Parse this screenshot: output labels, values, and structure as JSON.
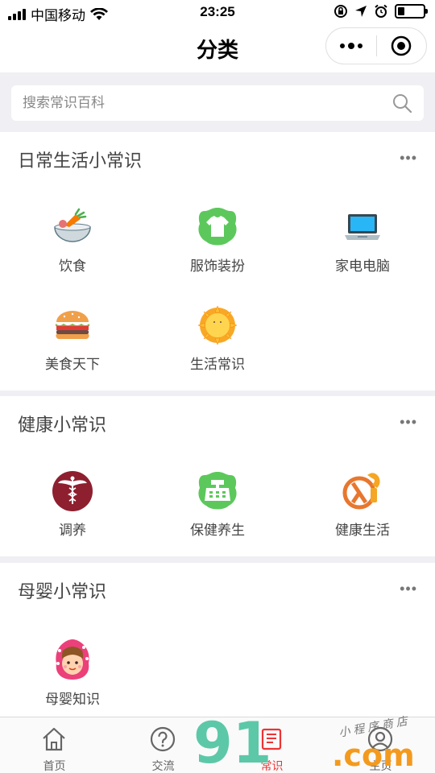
{
  "status_bar": {
    "carrier": "中国移动",
    "time": "23:25"
  },
  "navbar": {
    "title": "分类"
  },
  "search": {
    "placeholder": "搜索常识百科"
  },
  "sections": [
    {
      "title": "日常生活小常识",
      "more": "•••",
      "items": [
        {
          "label": "饮食",
          "icon": "food-bowl-icon"
        },
        {
          "label": "服饰装扮",
          "icon": "tshirt-icon"
        },
        {
          "label": "家电电脑",
          "icon": "laptop-icon"
        },
        {
          "label": "美食天下",
          "icon": "burger-icon"
        },
        {
          "label": "生活常识",
          "icon": "sun-icon"
        }
      ]
    },
    {
      "title": "健康小常识",
      "more": "•••",
      "items": [
        {
          "label": "调养",
          "icon": "caduceus-icon"
        },
        {
          "label": "保健养生",
          "icon": "register-icon"
        },
        {
          "label": "健康生活",
          "icon": "lambda-icon"
        }
      ]
    },
    {
      "title": "母婴小常识",
      "more": "•••",
      "items": [
        {
          "label": "母婴知识",
          "icon": "girl-avatar-icon"
        }
      ]
    }
  ],
  "tabbar": [
    {
      "label": "首页",
      "icon": "home-icon",
      "active": false
    },
    {
      "label": "交流",
      "icon": "question-icon",
      "active": false
    },
    {
      "label": "常识",
      "icon": "book-icon",
      "active": true
    },
    {
      "label": "主页",
      "icon": "user-icon",
      "active": false
    }
  ],
  "watermark": {
    "brand": "91",
    "domain": ".com",
    "caption": "小程序商店"
  },
  "colors": {
    "accent": "#e33333",
    "green": "#5cc85c",
    "watermark_green": "#5cc8a8",
    "watermark_orange": "#f39a1e"
  }
}
